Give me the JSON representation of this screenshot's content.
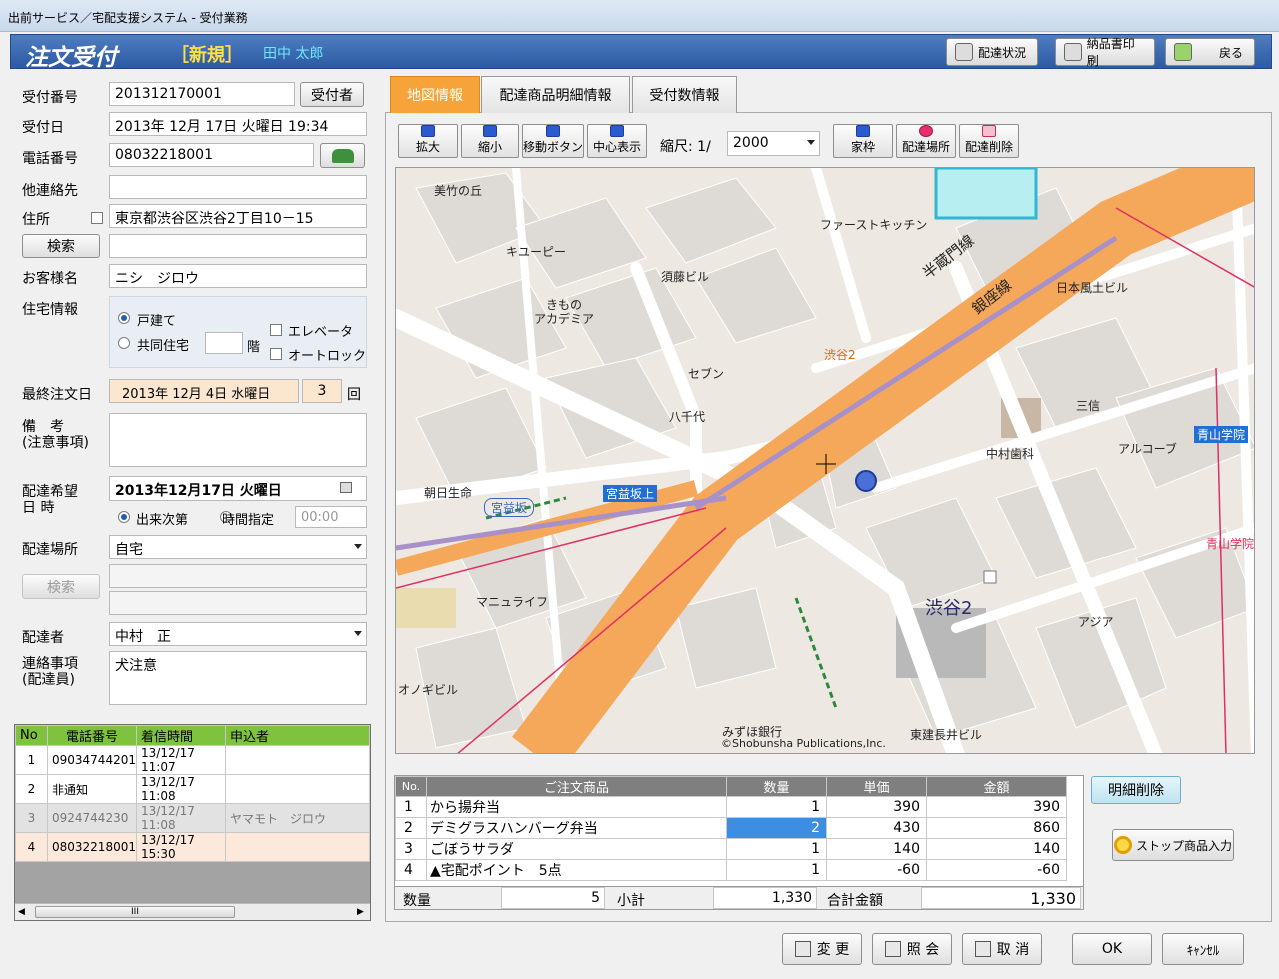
{
  "window": {
    "title": "出前サービス／宅配支援システム - 受付業務"
  },
  "header": {
    "title": "注文受付",
    "mode": "［新規］",
    "user": "田中 太郎",
    "buttons": {
      "delivery_status": "配達状況",
      "invoice_print": "納品書印刷",
      "back": "戻る"
    }
  },
  "form": {
    "labels": {
      "reception_no": "受付番号",
      "reception_date": "受付日",
      "phone": "電話番号",
      "other_contact": "他連絡先",
      "address": "住所",
      "customer_name": "お客様名",
      "housing": "住宅情報",
      "last_order": "最終注文日",
      "remarks": "備　考\n(注意事項)",
      "delivery_date": "配達希望\n日 時",
      "delivery_place": "配達場所",
      "courier": "配達者",
      "notes": "連絡事項\n(配達員)"
    },
    "reception_no": "201312170001",
    "receiver_button": "受付者",
    "reception_date": "2013年 12月 17日 火曜日 19:34",
    "phone": "08032218001",
    "other_contact": "",
    "address": "東京都渋谷区渋谷2丁目10－15",
    "address2": "",
    "search_button": "検索",
    "customer_name": "ニシ　ジロウ",
    "housing": {
      "detached": "戸建て",
      "apartment": "共同住宅",
      "floor": "",
      "floor_unit": "階",
      "elevator": "エレベータ",
      "autolock": "オートロック"
    },
    "last_order_date": "2013年 12月 4日 水曜日",
    "last_order_count": "3",
    "count_unit": "回",
    "remarks": "",
    "delivery_date": "2013年12月17日 火曜日",
    "asap": "出来次第",
    "time_spec": "時間指定",
    "time": "00:00",
    "delivery_place": "自宅",
    "place_search": "検索",
    "courier": "中村　正",
    "notes": "犬注意"
  },
  "calls": {
    "headers": [
      "No",
      "電話番号",
      "着信時間",
      "申込者"
    ],
    "rows": [
      {
        "no": "1",
        "phone": "09034744201",
        "time": "13/12/17 11:07",
        "name": ""
      },
      {
        "no": "2",
        "phone": "非通知",
        "time": "13/12/17 11:08",
        "name": ""
      },
      {
        "no": "3",
        "phone": "0924744230",
        "time": "13/12/17 11:08",
        "name": "ヤマモト　ジロウ"
      },
      {
        "no": "4",
        "phone": "08032218001",
        "time": "13/12/17 15:30",
        "name": ""
      }
    ],
    "scroll_thumb": "III"
  },
  "tabs": [
    "地図情報",
    "配達商品明細情報",
    "受付数情報"
  ],
  "map_toolbar": {
    "zoom_in": "拡大",
    "zoom_out": "縮小",
    "move": "移動ボタン",
    "center": "中心表示",
    "scale_label": "縮尺: 1/",
    "scale": "2000",
    "home": "家枠",
    "place": "配達場所",
    "delete": "配達削除"
  },
  "map_labels": {
    "l1": "美竹の丘",
    "l2": "キユーピー",
    "l3": "ファーストキッチン",
    "l4": "須藤ビル",
    "l5": "きもの\nアカデミア",
    "l6": "セブン",
    "l7": "八千代",
    "l8": "日本風土ビル",
    "l9": "三信",
    "l10": "アルコーブ",
    "l11": "青山学院",
    "l12": "中村歯科",
    "l13": "朝日生命",
    "l14": "宮益坂",
    "l15": "宮益坂上",
    "l16": "渋谷2",
    "l17": "マニュライフ",
    "l18": "アジア",
    "l19": "オノギビル",
    "l20": "みずほ銀行",
    "l21": "東建長井ビル",
    "l22": "半蔵門線",
    "l23": "銀座線",
    "l24": "渋谷2",
    "l25": "青山学院",
    "copyright": "©Shobunsha Publications,Inc."
  },
  "items": {
    "headers": [
      "No.",
      "ご注文商品",
      "数量",
      "単価",
      "金額"
    ],
    "rows": [
      {
        "no": "1",
        "name": "から揚弁当",
        "qty": "1",
        "price": "390",
        "amount": "390"
      },
      {
        "no": "2",
        "name": "デミグラスハンバーグ弁当",
        "qty": "2",
        "price": "430",
        "amount": "860"
      },
      {
        "no": "3",
        "name": "ごぼうサラダ",
        "qty": "1",
        "price": "140",
        "amount": "140"
      },
      {
        "no": "4",
        "name": "▲宅配ポイント　5点",
        "qty": "1",
        "price": "-60",
        "amount": "-60"
      }
    ],
    "footer": {
      "qty_label": "数量",
      "qty": "5",
      "subtotal_label": "小計",
      "subtotal": "1,330",
      "total_label": "合計金額",
      "total": "1,330"
    }
  },
  "side_buttons": {
    "delete_detail": "明細削除",
    "stop_item": "ストップ商品入力"
  },
  "bottom_buttons": {
    "change": "変 更",
    "inquiry": "照 会",
    "cancel_order": "取 消",
    "ok": "OK",
    "cancel": "ｷｬﾝｾﾙ"
  }
}
